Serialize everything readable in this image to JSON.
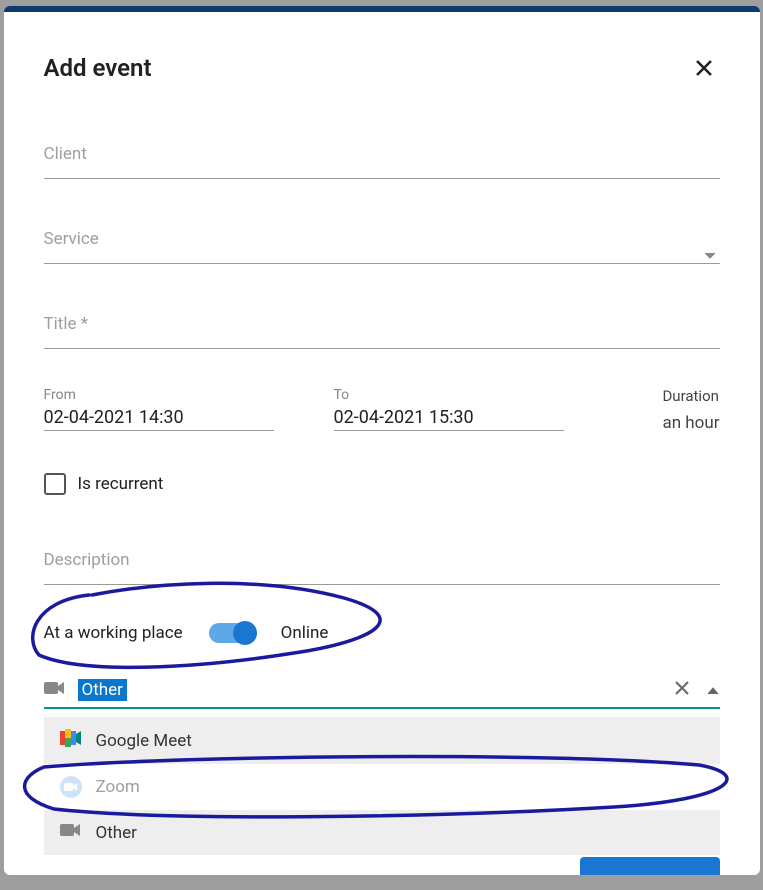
{
  "modal": {
    "title": "Add event"
  },
  "fields": {
    "client_label": "Client",
    "service_label": "Service",
    "title_label": "Title *",
    "description_label": "Description"
  },
  "dates": {
    "from_label": "From",
    "from_value": "02-04-2021 14:30",
    "to_label": "To",
    "to_value": "02-04-2021 15:30",
    "duration_label": "Duration",
    "duration_value": "an hour"
  },
  "recurrent": {
    "label": "Is recurrent",
    "checked": false
  },
  "location": {
    "working_place_label": "At a working place",
    "online_label": "Online",
    "is_online": true
  },
  "video": {
    "selected": "Other",
    "options": [
      {
        "label": "Google Meet",
        "icon": "google-meet"
      },
      {
        "label": "Zoom",
        "icon": "zoom"
      },
      {
        "label": "Other",
        "icon": "camcorder"
      }
    ]
  }
}
